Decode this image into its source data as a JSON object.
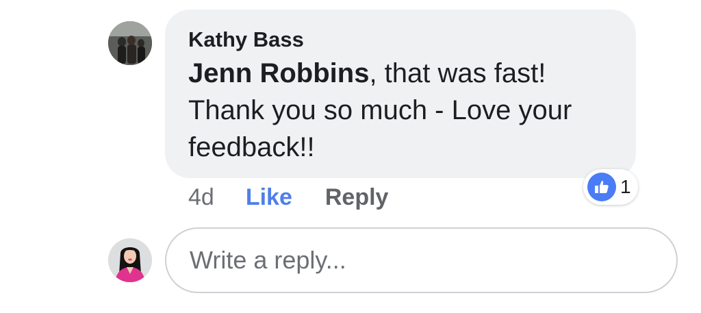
{
  "comment": {
    "author": "Kathy Bass",
    "mention": "Jenn Robbins",
    "text_line1": ", that was fast!",
    "text_rest": "Thank you so much - Love your feedback!!",
    "reaction_icon": "thumbs-up-icon",
    "reaction_count": "1",
    "timestamp": "4d",
    "like_label": "Like",
    "reply_label": "Reply"
  },
  "reply_input": {
    "placeholder": "Write a reply..."
  },
  "colors": {
    "bubble": "#f0f1f3",
    "like_blue": "#4f7fe8",
    "reaction_blue": "#4a7cf5",
    "muted_text": "#6b6e73"
  }
}
